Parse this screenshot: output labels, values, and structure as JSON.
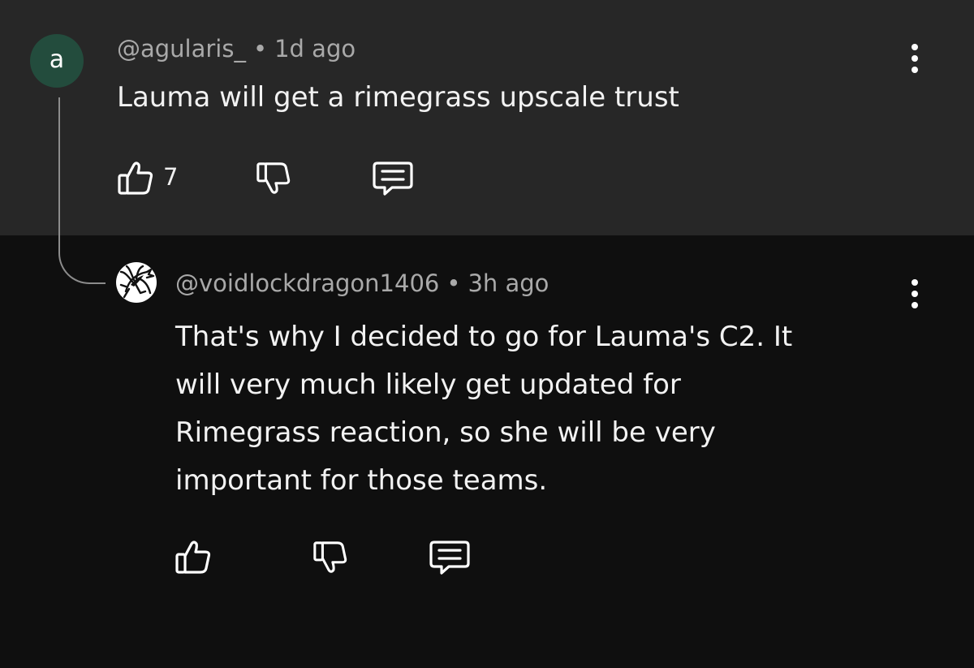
{
  "comment": {
    "avatar_letter": "a",
    "author": "@agularis_",
    "separator": "•",
    "time": "1d ago",
    "text": "Lauma will get a rimegrass upscale trust",
    "like_count": "7",
    "icons": [
      "thumbs-up-icon",
      "thumbs-down-icon",
      "reply-icon",
      "more-vertical-icon"
    ]
  },
  "reply": {
    "avatar": "dragon-avatar",
    "author": "@voidlockdragon1406",
    "separator": "•",
    "time": "3h ago",
    "text_lines": [
      "That's why I decided to go for Lauma's C2. It",
      "will very much likely get updated for",
      "Rimegrass reaction, so she will be very",
      "important for those teams."
    ],
    "icons": [
      "thumbs-up-icon",
      "thumbs-down-icon",
      "reply-icon",
      "more-vertical-icon"
    ]
  },
  "colors": {
    "comment_bg": "#272727",
    "reply_bg": "#0f0f0f",
    "avatar_bg": "#234c3d",
    "meta_text": "#a9a9a9",
    "body_text": "#f2f2f2"
  }
}
